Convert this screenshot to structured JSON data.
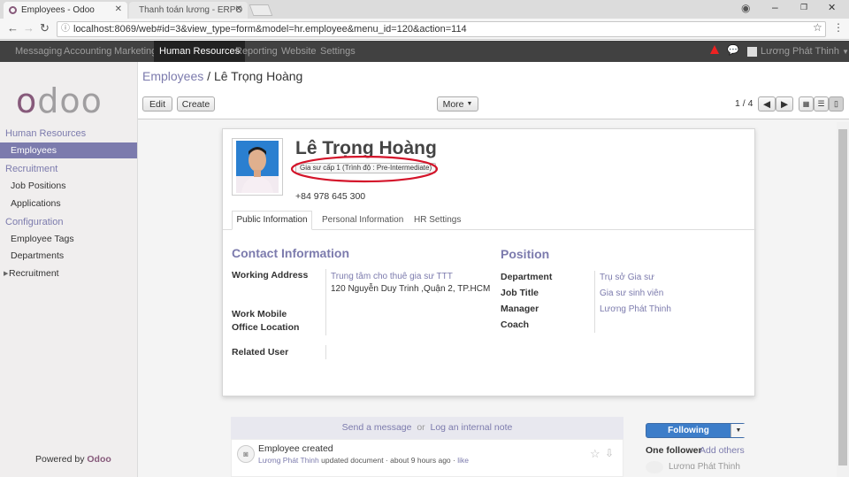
{
  "browser": {
    "tabs": [
      {
        "title": "Employees - Odoo"
      },
      {
        "title": "Thanh toán lương - ERPO"
      }
    ],
    "url": "localhost:8069/web#id=3&view_type=form&model=hr.employee&menu_id=120&action=114"
  },
  "topnav": {
    "items": [
      "Messaging",
      "Accounting",
      "Marketing",
      "Human Resources",
      "Reporting",
      "Website",
      "Settings"
    ],
    "user": "Lương Phát Thinh"
  },
  "sidebar": {
    "logo": "odoo",
    "sections": [
      {
        "header": "Human Resources",
        "items": [
          "Employees"
        ]
      },
      {
        "header": "Recruitment",
        "items": [
          "Job Positions",
          "Applications"
        ]
      },
      {
        "header": "Configuration",
        "items": [
          "Employee Tags",
          "Departments",
          "Recruitment"
        ]
      }
    ],
    "powered_by": "Powered by",
    "powered_brand": "Odoo"
  },
  "control": {
    "breadcrumb_root": "Employees",
    "breadcrumb_sep": " / ",
    "breadcrumb_current": "Lê Trọng Hoàng",
    "edit": "Edit",
    "create": "Create",
    "more": "More",
    "pager": "1 / 4"
  },
  "employee": {
    "name": "Lê Trọng Hoàng",
    "tag": "Gia sư cấp 1 (Trình độ : Pre-Intermediate)",
    "phone": "+84 978 645 300"
  },
  "form_tabs": [
    "Public Information",
    "Personal Information",
    "HR Settings"
  ],
  "contact": {
    "title": "Contact Information",
    "working_address_label": "Working Address",
    "working_address_line1": "Trung tâm cho thuê gia sư TTT",
    "working_address_line2": "120 Nguyễn Duy Trinh ,Quận 2, TP.HCM",
    "work_mobile_label": "Work Mobile",
    "office_location_label": "Office Location",
    "related_user_label": "Related User"
  },
  "position": {
    "title": "Position",
    "department_label": "Department",
    "department": "Trụ sở Gia sư",
    "job_title_label": "Job Title",
    "job_title": "Gia sư sinh viên",
    "manager_label": "Manager",
    "manager": "Lương Phát Thinh",
    "coach_label": "Coach"
  },
  "chatter": {
    "send_message": "Send a message",
    "or": "or",
    "log_note": "Log an internal note",
    "entry_title": "Employee created",
    "entry_author": "Lương Phát Thinh",
    "entry_text": "updated document",
    "entry_time": "about 9 hours ago",
    "entry_like": "like",
    "following": "Following",
    "one_follower": "One follower",
    "add_others": "Add others",
    "follower_name": "Lương Phát Thinh"
  }
}
